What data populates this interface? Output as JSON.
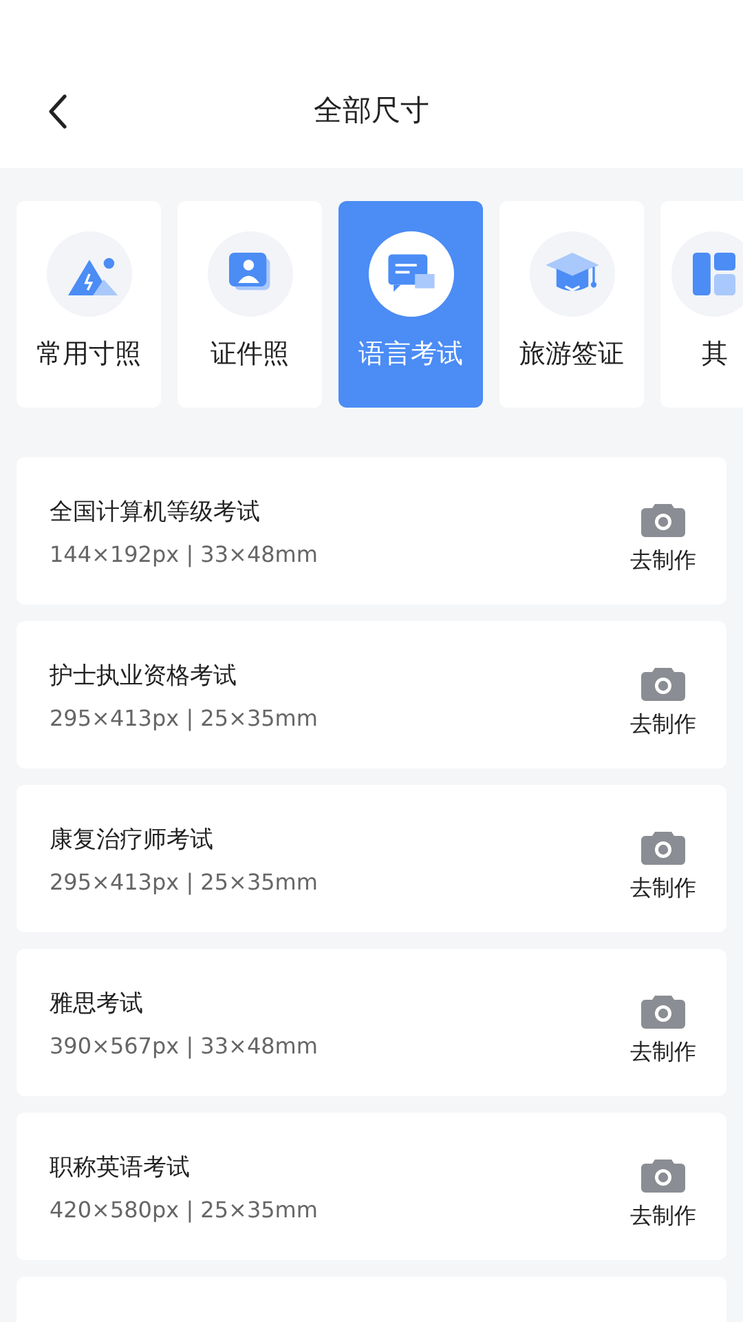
{
  "header": {
    "title": "全部尺寸"
  },
  "categories": [
    {
      "kind": "full",
      "label": "常用寸照",
      "selected": false
    },
    {
      "kind": "full",
      "label": "证件照",
      "selected": false
    },
    {
      "kind": "full",
      "label": "语言考试",
      "selected": true
    },
    {
      "kind": "full",
      "label": "旅游签证",
      "selected": false
    },
    {
      "kind": "partial",
      "label": "其",
      "selected": false
    }
  ],
  "sizes": [
    {
      "kind": "item",
      "name": "全国计算机等级考试",
      "spec": "144×192px | 33×48mm",
      "action": "去制作"
    },
    {
      "kind": "item",
      "name": "护士执业资格考试",
      "spec": "295×413px | 25×35mm",
      "action": "去制作"
    },
    {
      "kind": "item",
      "name": "康复治疗师考试",
      "spec": "295×413px | 25×35mm",
      "action": "去制作"
    },
    {
      "kind": "item",
      "name": "雅思考试",
      "spec": "390×567px | 33×48mm",
      "action": "去制作"
    },
    {
      "kind": "item",
      "name": "职称英语考试",
      "spec": "420×580px | 25×35mm",
      "action": "去制作"
    },
    {
      "kind": "cut"
    }
  ]
}
